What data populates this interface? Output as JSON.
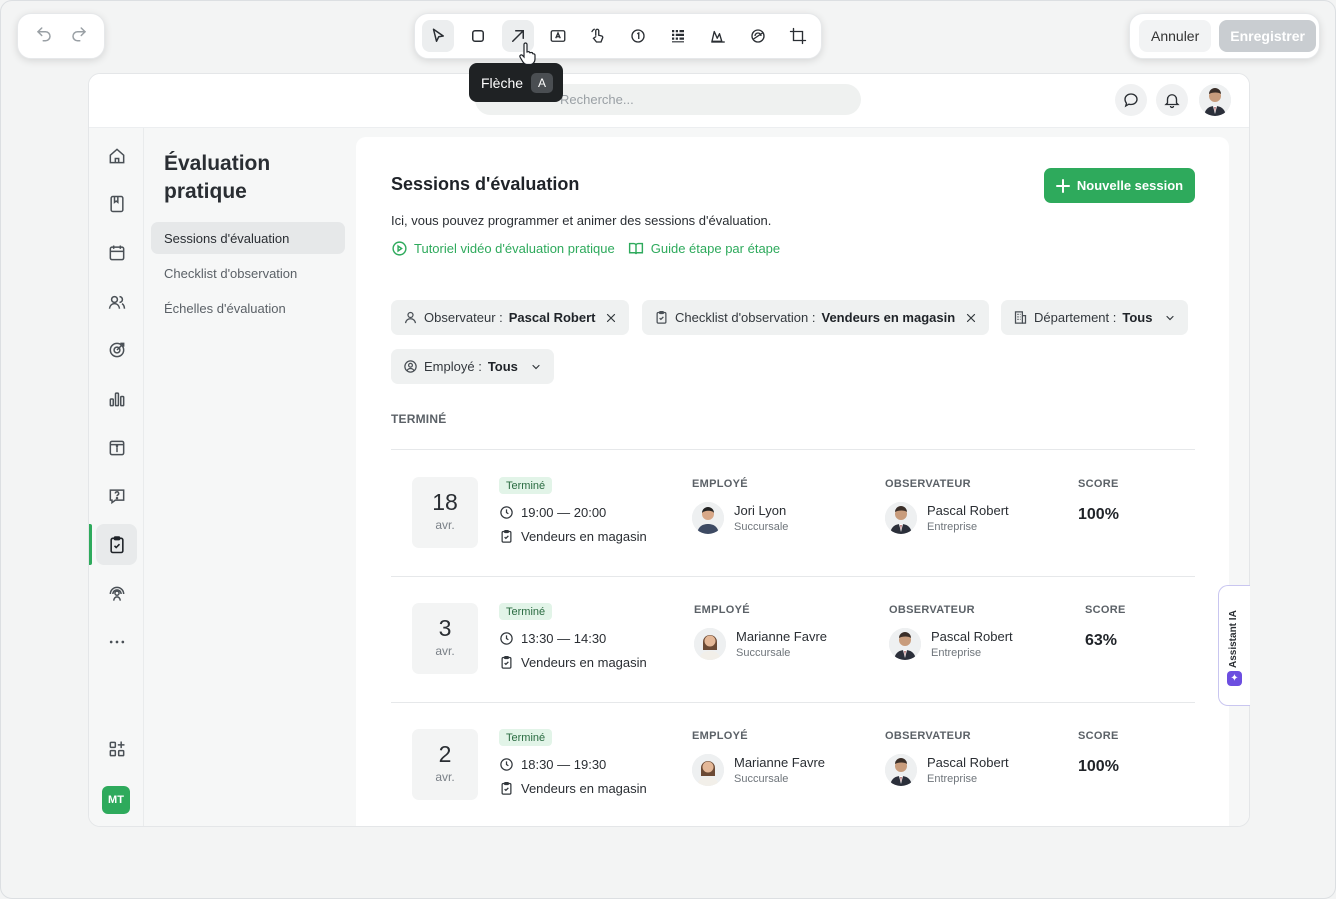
{
  "editor": {
    "cancel_label": "Annuler",
    "save_label": "Enregistrer",
    "tooltip": {
      "label": "Flèche",
      "shortcut": "A"
    }
  },
  "topbar": {
    "search_placeholder": "Recherche..."
  },
  "user_initials": "MT",
  "subnav": {
    "title": "Évaluation pratique",
    "items": [
      {
        "label": "Sessions d'évaluation"
      },
      {
        "label": "Checklist d'observation"
      },
      {
        "label": "Échelles d'évaluation"
      }
    ]
  },
  "main": {
    "title": "Sessions d'évaluation",
    "new_session_label": "Nouvelle session",
    "description": "Ici, vous pouvez programmer et animer des sessions d'évaluation.",
    "link_video": "Tutoriel vidéo d'évaluation pratique",
    "link_guide": "Guide étape par étape",
    "filters": {
      "observer_key": "Observateur :",
      "observer_value": "Pascal Robert",
      "checklist_key": "Checklist d'observation :",
      "checklist_value": "Vendeurs en magasin",
      "department_key": "Département :",
      "department_value": "Tous",
      "employee_key": "Employé :",
      "employee_value": "Tous"
    },
    "section_label": "TERMINÉ",
    "col_employee": "EMPLOYÉ",
    "col_observer": "OBSERVATEUR",
    "col_score": "SCORE",
    "sessions": [
      {
        "day": "18",
        "month": "avr.",
        "status": "Terminé",
        "time": "19:00 — 20:00",
        "checklist": "Vendeurs en magasin",
        "employee": "Jori Lyon",
        "employee_role": "Succursale",
        "observer": "Pascal Robert",
        "observer_role": "Entreprise",
        "score": "100%"
      },
      {
        "day": "3",
        "month": "avr.",
        "status": "Terminé",
        "time": "13:30 — 14:30",
        "checklist": "Vendeurs en magasin",
        "employee": "Marianne Favre",
        "employee_role": "Succursale",
        "observer": "Pascal Robert",
        "observer_role": "Entreprise",
        "score": "63%"
      },
      {
        "day": "2",
        "month": "avr.",
        "status": "Terminé",
        "time": "18:30 — 19:30",
        "checklist": "Vendeurs en magasin",
        "employee": "Marianne Favre",
        "employee_role": "Succursale",
        "observer": "Pascal Robert",
        "observer_role": "Entreprise",
        "score": "100%"
      }
    ]
  },
  "assistant_label": "Assistant IA",
  "colors": {
    "accent": "#2eaa5c",
    "assistant": "#6c4ee0"
  }
}
